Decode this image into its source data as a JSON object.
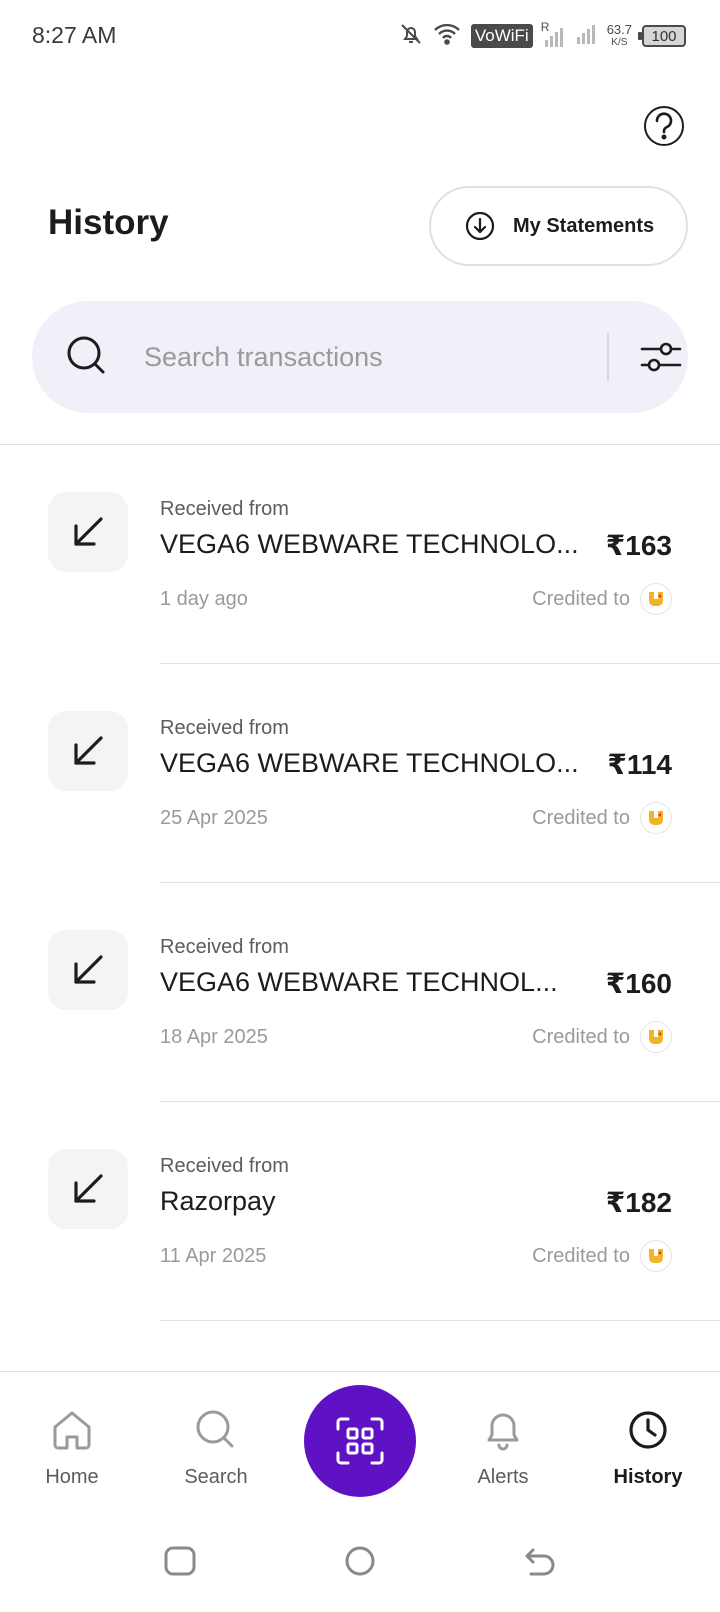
{
  "status_bar": {
    "time": "8:27 AM",
    "network_label": "VoWiFi",
    "roaming": "R",
    "speed_value": "63.7",
    "speed_unit": "K/S",
    "battery": "100"
  },
  "header": {
    "title": "History",
    "statements_label": "My Statements"
  },
  "search": {
    "placeholder": "Search transactions"
  },
  "transactions": [
    {
      "label": "Received from",
      "name": "VEGA6 WEBWARE TECHNOLO...",
      "amount": "₹163",
      "date": "1 day ago",
      "credited_label": "Credited to",
      "icon": "arrow-down-left-icon"
    },
    {
      "label": "Received from",
      "name": "VEGA6 WEBWARE TECHNOLO...",
      "amount": "₹114",
      "date": "25 Apr 2025",
      "credited_label": "Credited to",
      "icon": "arrow-down-left-icon"
    },
    {
      "label": "Received from",
      "name": "VEGA6 WEBWARE TECHNOL...",
      "amount": "₹160",
      "date": "18 Apr 2025",
      "credited_label": "Credited to",
      "icon": "arrow-down-left-icon"
    },
    {
      "label": "Received from",
      "name": "Razorpay",
      "amount": "₹182",
      "date": "11 Apr 2025",
      "credited_label": "Credited to",
      "icon": "arrow-down-left-icon"
    }
  ],
  "bottom_nav": {
    "items": [
      {
        "label": "Home",
        "icon": "home-icon"
      },
      {
        "label": "Search",
        "icon": "search-icon"
      },
      {
        "label": "",
        "icon": "qr-scan-icon"
      },
      {
        "label": "Alerts",
        "icon": "bell-icon"
      },
      {
        "label": "History",
        "icon": "clock-icon",
        "active": true
      }
    ]
  },
  "colors": {
    "accent": "#5f12c4",
    "search_bg": "#f1eff8",
    "bank_logo": "#f0b429"
  }
}
